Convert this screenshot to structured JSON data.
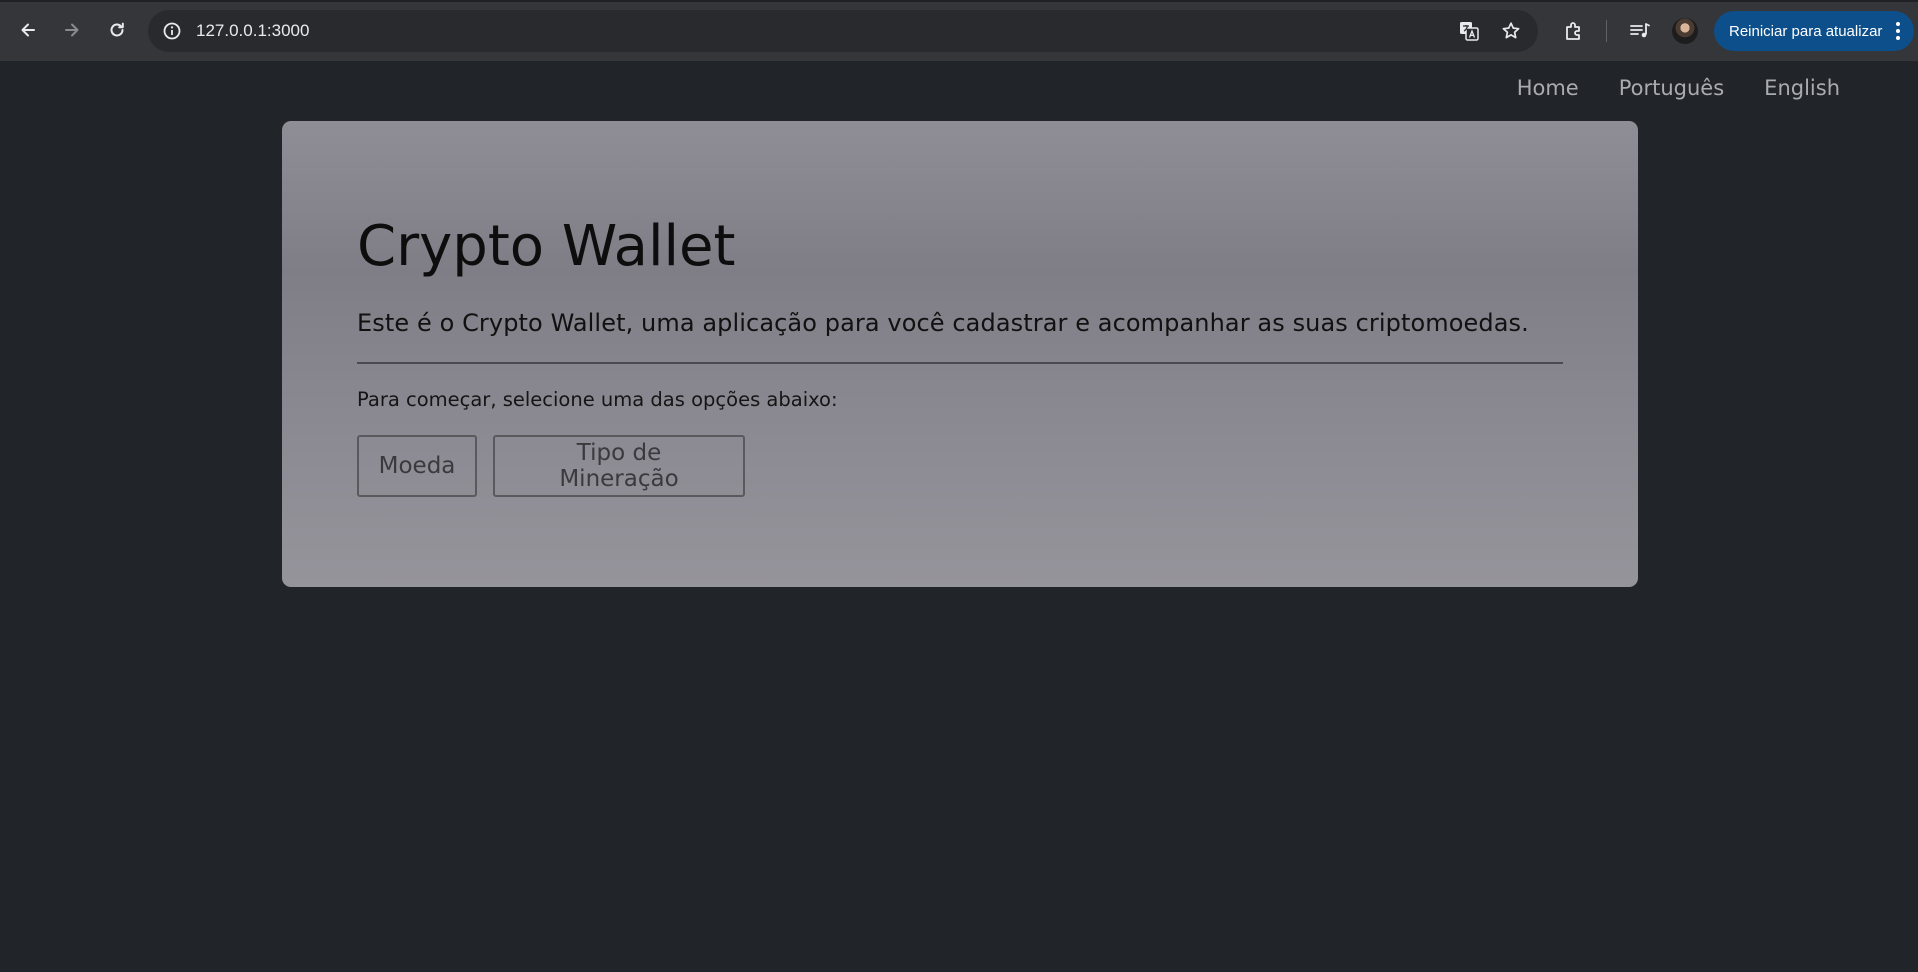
{
  "browser": {
    "url": "127.0.0.1:3000",
    "update_button_label": "Reiniciar para atualizar",
    "icons": [
      "back-icon",
      "forward-icon",
      "reload-icon",
      "site-info-icon",
      "translate-icon",
      "bookmark-star-icon",
      "extensions-icon",
      "media-controls-icon",
      "profile-avatar",
      "kebab-menu-icon"
    ],
    "update_button_color": "#0d4f8b"
  },
  "nav": {
    "items": [
      {
        "label": "Home"
      },
      {
        "label": "Português"
      },
      {
        "label": "English"
      }
    ]
  },
  "jumbotron": {
    "title": "Crypto Wallet",
    "lead": "Este é o Crypto Wallet, uma aplicação para você cadastrar e acompanhar as suas criptomoedas.",
    "prompt": "Para começar, selecione uma das opções abaixo:",
    "buttons": [
      {
        "label": "Moeda"
      },
      {
        "label": "Tipo de Mineração"
      }
    ]
  },
  "colors": {
    "page_background": "#212428",
    "card_background": "#8a8890",
    "nav_text": "#a9abb0"
  }
}
